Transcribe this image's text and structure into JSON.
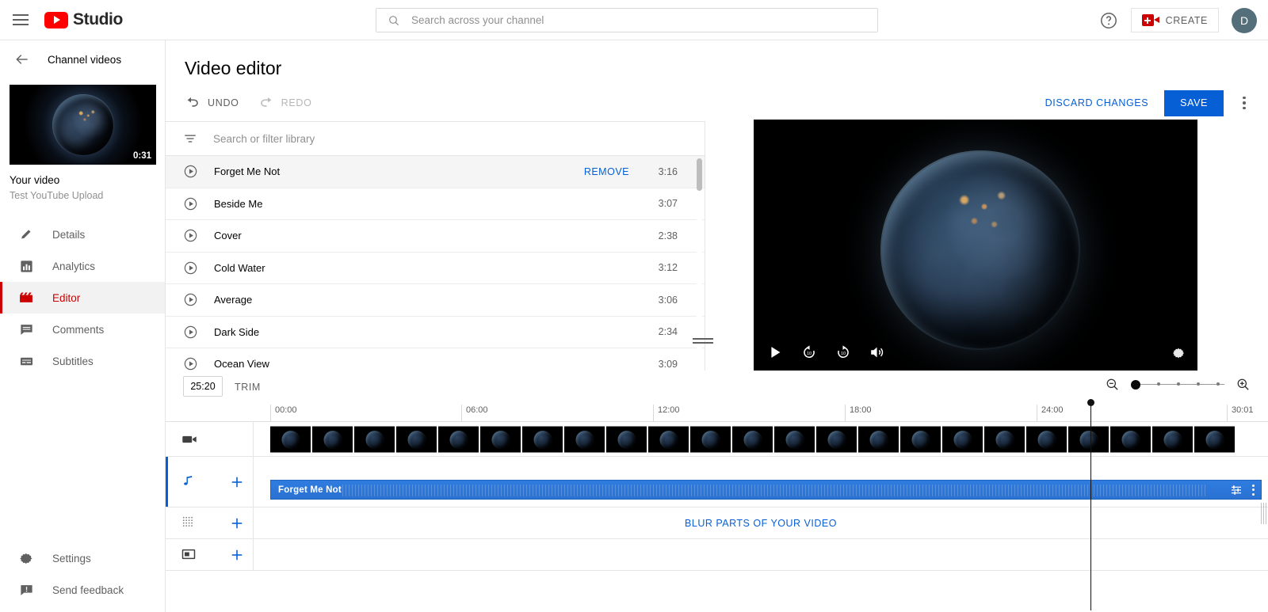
{
  "topbar": {
    "brand": "Studio",
    "search_placeholder": "Search across your channel",
    "create_label": "CREATE",
    "avatar_letter": "D"
  },
  "sidebar": {
    "back_label": "Channel videos",
    "thumb_duration": "0:31",
    "video_title": "Your video",
    "video_subtitle": "Test YouTube Upload",
    "items": [
      {
        "label": "Details",
        "icon": "pencil-icon",
        "active": false
      },
      {
        "label": "Analytics",
        "icon": "bar-chart-icon",
        "active": false
      },
      {
        "label": "Editor",
        "icon": "clapperboard-icon",
        "active": true
      },
      {
        "label": "Comments",
        "icon": "comment-icon",
        "active": false
      },
      {
        "label": "Subtitles",
        "icon": "subtitles-icon",
        "active": false
      }
    ],
    "bottom_items": [
      {
        "label": "Settings",
        "icon": "gear-icon"
      },
      {
        "label": "Send feedback",
        "icon": "feedback-icon"
      }
    ]
  },
  "main": {
    "page_title": "Video editor",
    "undo_label": "UNDO",
    "redo_label": "REDO",
    "discard_label": "DISCARD CHANGES",
    "save_label": "SAVE"
  },
  "library": {
    "search_placeholder": "Search or filter library",
    "remove_label": "REMOVE",
    "tracks": [
      {
        "name": "Forget Me Not",
        "duration": "3:16",
        "selected": true
      },
      {
        "name": "Beside Me",
        "duration": "3:07",
        "selected": false
      },
      {
        "name": "Cover",
        "duration": "2:38",
        "selected": false
      },
      {
        "name": "Cold Water",
        "duration": "3:12",
        "selected": false
      },
      {
        "name": "Average",
        "duration": "3:06",
        "selected": false
      },
      {
        "name": "Dark Side",
        "duration": "2:34",
        "selected": false
      },
      {
        "name": "Ocean View",
        "duration": "3:09",
        "selected": false
      }
    ]
  },
  "timeline": {
    "timecode": "25:20",
    "trim_label": "TRIM",
    "ruler_marks": [
      "00:00",
      "06:00",
      "12:00",
      "18:00",
      "24:00",
      "30:01"
    ],
    "audio_clip_name": "Forget Me Not",
    "blur_cta": "BLUR PARTS OF YOUR VIDEO"
  },
  "colors": {
    "accent_blue": "#065fd4",
    "youtube_red": "#cc0000",
    "clip_blue": "#2f7ce0"
  }
}
